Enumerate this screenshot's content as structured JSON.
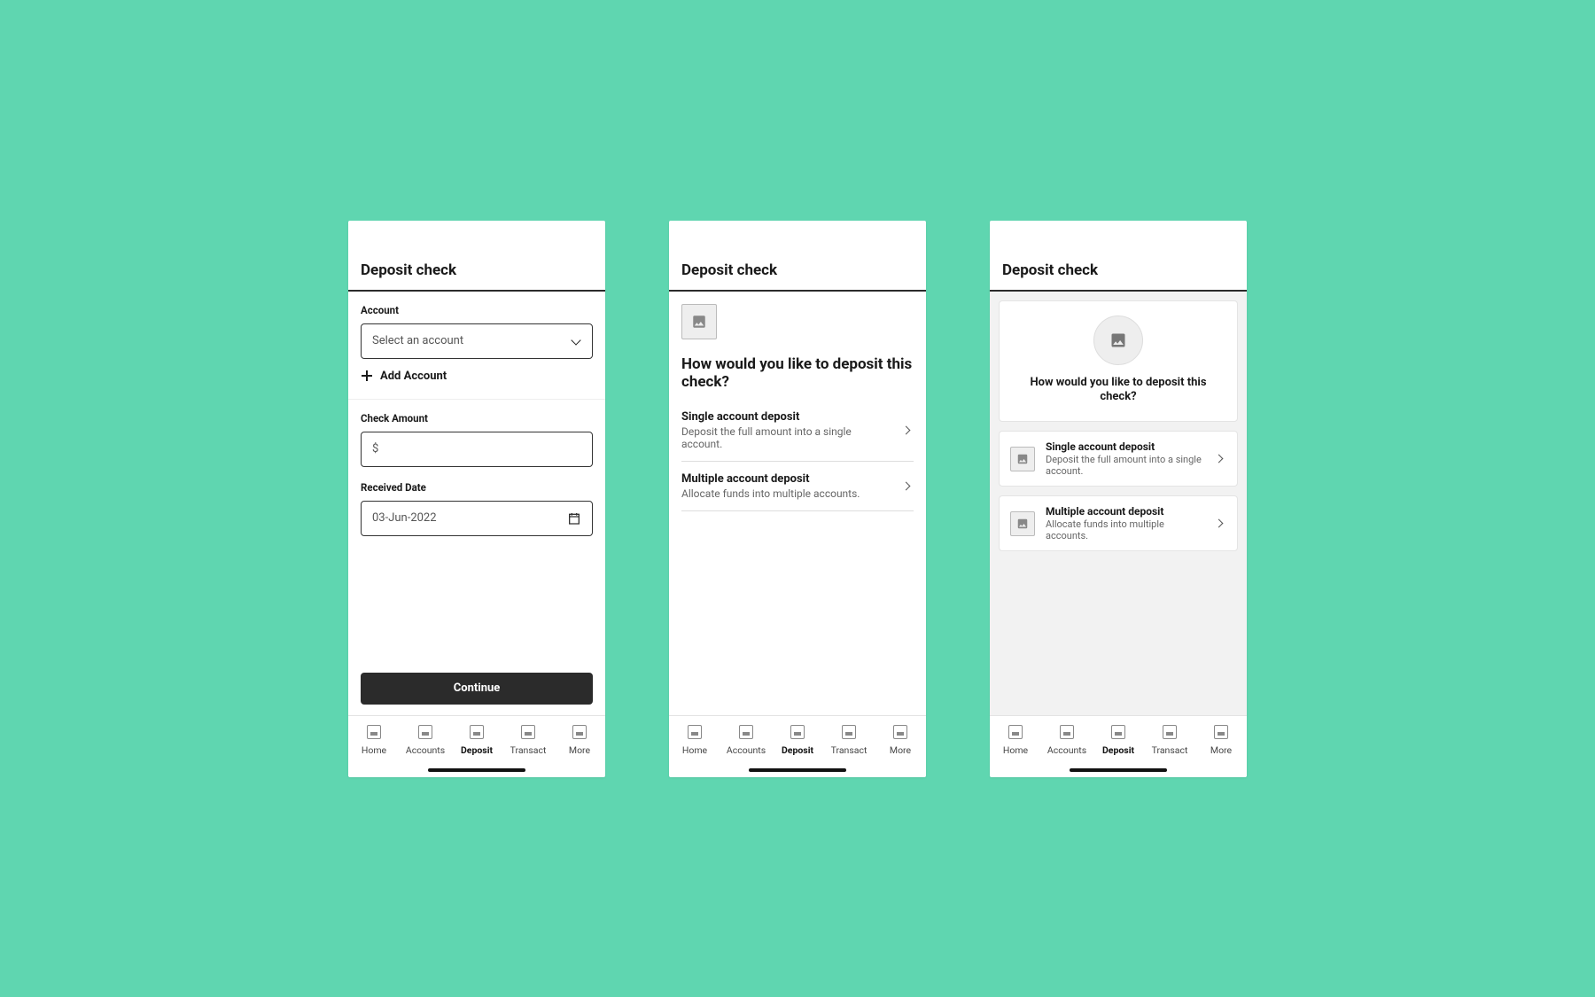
{
  "screen1": {
    "title": "Deposit check",
    "account_label": "Account",
    "account_placeholder": "Select an account",
    "add_account": "Add Account",
    "check_amount_label": "Check Amount",
    "check_amount_value": "$",
    "received_date_label": "Received Date",
    "received_date_value": "03-Jun-2022",
    "continue": "Continue"
  },
  "screen2": {
    "title": "Deposit check",
    "heading": "How would you like to deposit this check?",
    "options": [
      {
        "title": "Single account deposit",
        "sub": "Deposit the full amount into a single account."
      },
      {
        "title": "Multiple account deposit",
        "sub": "Allocate funds into multiple accounts."
      }
    ]
  },
  "screen3": {
    "title": "Deposit check",
    "heading": "How would you like to deposit this check?",
    "options": [
      {
        "title": "Single account deposit",
        "sub": "Deposit the full amount into a single account."
      },
      {
        "title": "Multiple account deposit",
        "sub": "Allocate funds into multiple accounts."
      }
    ]
  },
  "tabbar": {
    "items": [
      "Home",
      "Accounts",
      "Deposit",
      "Transact",
      "More"
    ],
    "active": "Deposit"
  }
}
